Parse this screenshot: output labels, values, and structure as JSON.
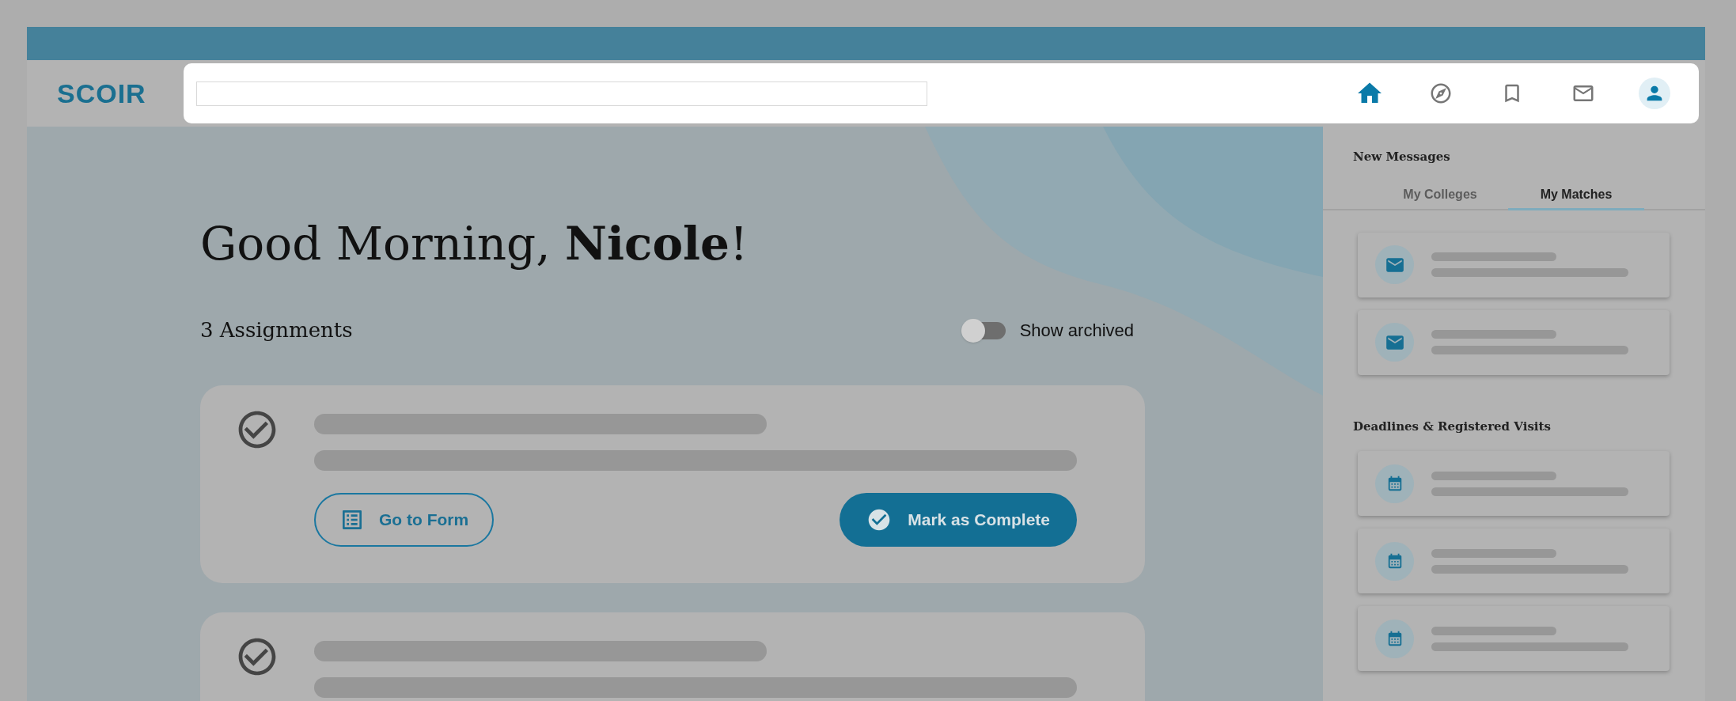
{
  "brand": {
    "logo": "SCOIR"
  },
  "nav": [
    {
      "kind": "home",
      "selected": true
    },
    {
      "kind": "explore",
      "selected": false
    },
    {
      "kind": "bookmark",
      "selected": false
    },
    {
      "kind": "mail",
      "selected": false
    }
  ],
  "profile_avatar": {
    "kind": "person"
  },
  "greeting": "Good Morning, **Nicole**!",
  "assignments_count": "3 Assignments",
  "archive_toggle": {
    "label": "Show archived",
    "on": false
  },
  "assignments": [
    {
      "kind": "skeleton",
      "actions": [
        {
          "kind": "form",
          "label": "Go to Form"
        },
        {
          "kind": "complete",
          "label": "Mark as Complete"
        }
      ]
    },
    {
      "kind": "skeleton"
    }
  ],
  "messages": {
    "title": "New Messages",
    "tabs": [
      {
        "label": "My Colleges",
        "selected": false
      },
      {
        "label": "My Matches",
        "selected": true
      }
    ],
    "items": [
      {
        "kind": "message"
      },
      {
        "kind": "message"
      }
    ]
  },
  "deadlines": {
    "title": "Deadlines & Registered Visits",
    "items": [
      {
        "kind": "event"
      },
      {
        "kind": "event"
      },
      {
        "kind": "event"
      }
    ]
  }
}
